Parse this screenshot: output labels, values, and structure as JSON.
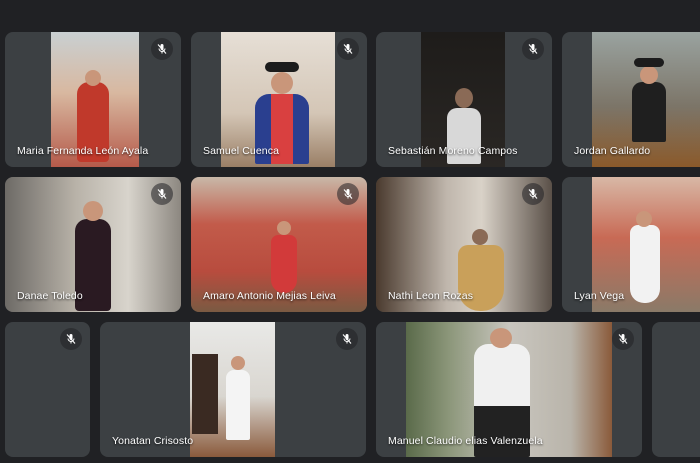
{
  "participants": [
    {
      "name": "Maria Fernanda León Ayala"
    },
    {
      "name": "Samuel Cuenca"
    },
    {
      "name": "Sebastián Moreno Campos"
    },
    {
      "name": "Jordan Gallardo"
    },
    {
      "name": "Danae Toledo"
    },
    {
      "name": "Amaro Antonio Mejias Leiva"
    },
    {
      "name": "Nathi Leon Rozas"
    },
    {
      "name": "Lyan Vega"
    },
    {
      "name": ""
    },
    {
      "name": "Yonatan Crisosto"
    },
    {
      "name": "Manuel Claudio elias Valenzuela"
    },
    {
      "name": ""
    }
  ],
  "icons": {
    "muted": "mic-off-icon"
  },
  "colors": {
    "background": "#202124",
    "tile": "#3c4043",
    "name_text": "#ffffff"
  }
}
